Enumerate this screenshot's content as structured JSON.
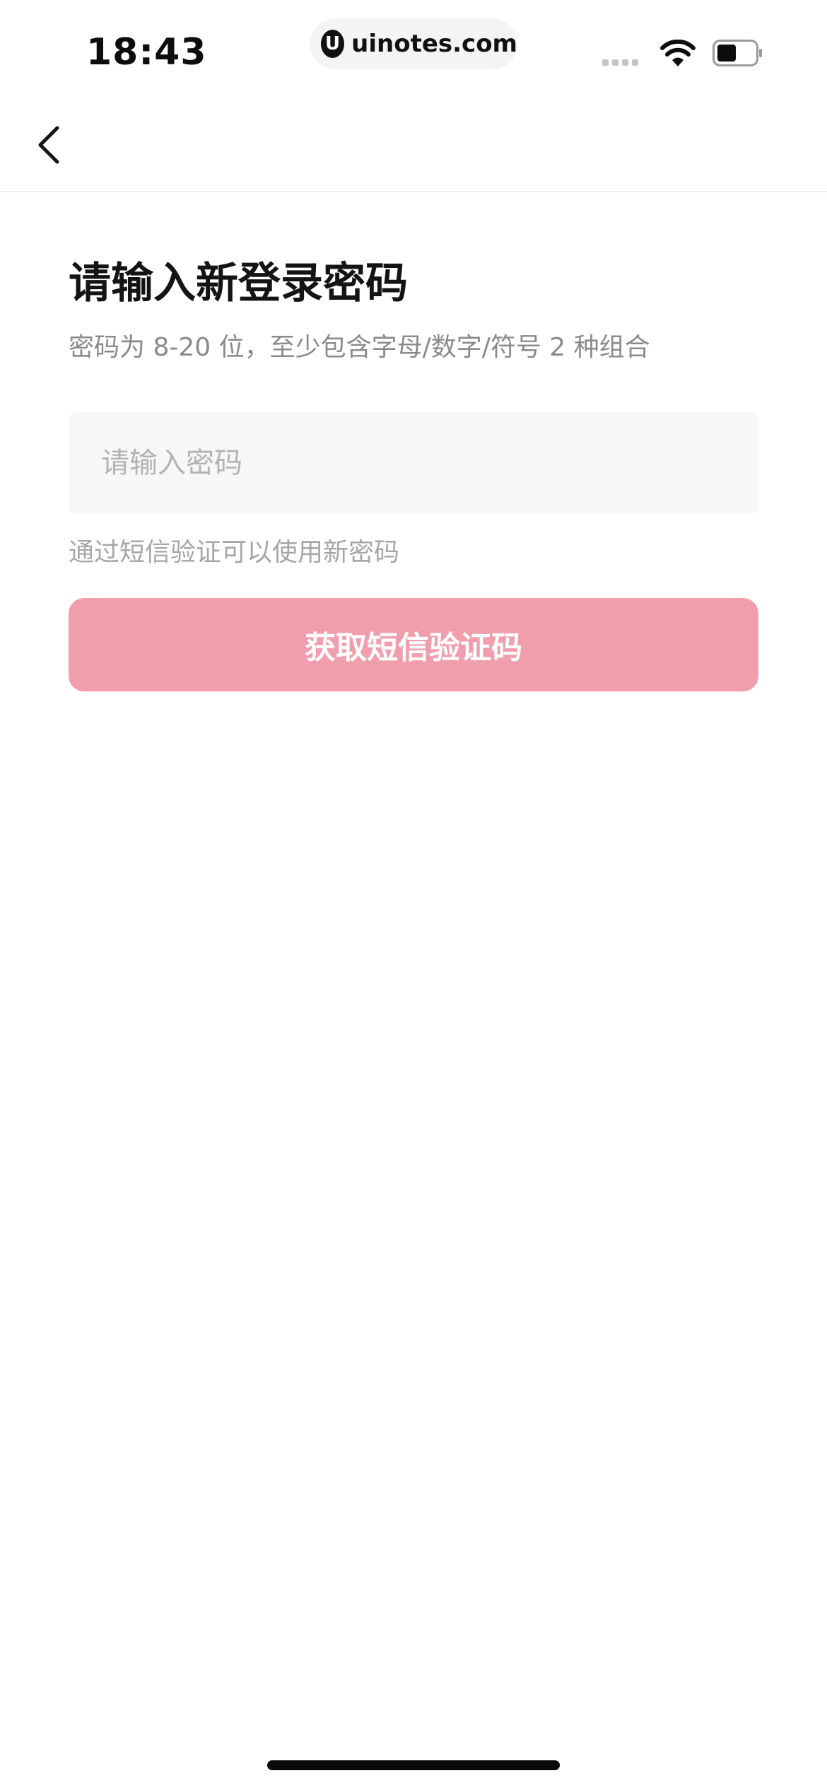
{
  "status_bar": {
    "time": "18:43",
    "url": "uinotes.com",
    "url_logo_glyph": "U",
    "icons": [
      "cellular-signal-icon",
      "wifi-icon",
      "battery-icon"
    ]
  },
  "nav": {
    "back_icon": "chevron-left-icon"
  },
  "content": {
    "title": "请输入新登录密码",
    "subtitle": "密码为 8-20 位，至少包含字母/数字/符号 2 种组合",
    "password_placeholder": "请输入密码",
    "password_value": "",
    "hint": "通过短信验证可以使用新密码",
    "sms_button_label": "获取短信验证码"
  },
  "colors": {
    "primary_button": "#f09eab",
    "title_text": "#141414",
    "subtitle_text": "#8a8a8a",
    "hint_text": "#a6a6a6",
    "input_background": "#f7f7f7"
  }
}
